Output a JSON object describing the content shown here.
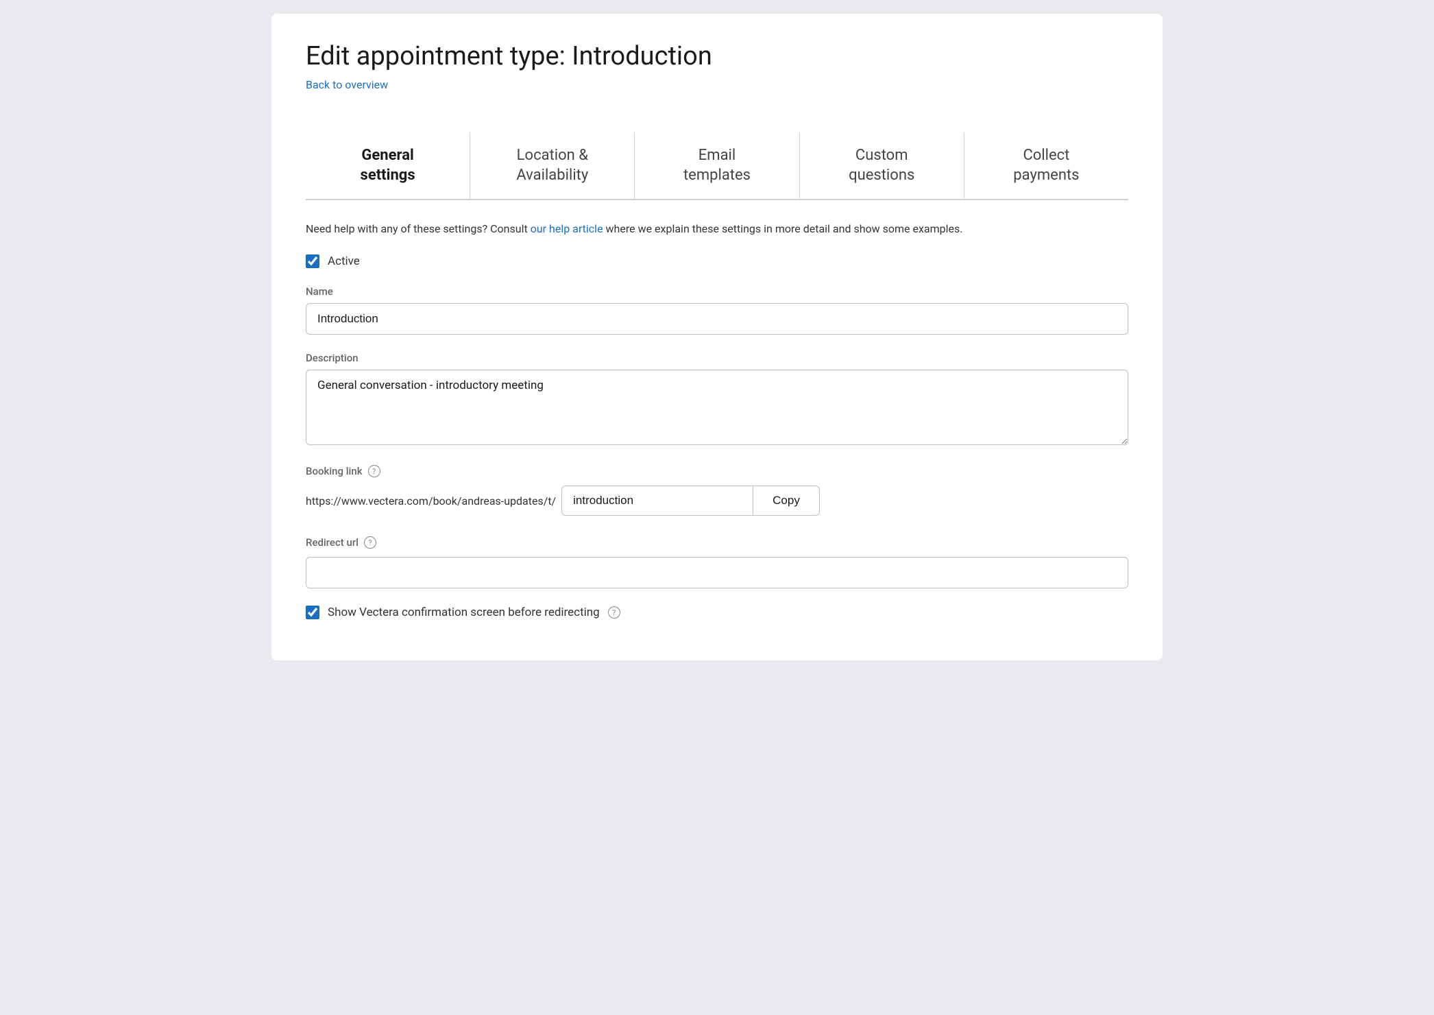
{
  "page": {
    "title": "Edit appointment type: Introduction",
    "back_link": "Back to overview"
  },
  "tabs": [
    {
      "id": "general",
      "label": "General\nsettings",
      "active": true
    },
    {
      "id": "location",
      "label": "Location &\nAvailability",
      "active": false
    },
    {
      "id": "email",
      "label": "Email\ntemplates",
      "active": false
    },
    {
      "id": "custom",
      "label": "Custom\nquestions",
      "active": false
    },
    {
      "id": "payments",
      "label": "Collect\npayments",
      "active": false
    }
  ],
  "help": {
    "text_before": "Need help with any of these settings? Consult ",
    "link_text": "our help article",
    "text_after": " where we explain these settings in more detail and show some examples."
  },
  "active_checkbox": {
    "label": "Active",
    "checked": true
  },
  "name_field": {
    "label": "Name",
    "value": "Introduction",
    "placeholder": ""
  },
  "description_field": {
    "label": "Description",
    "value": "General conversation - introductory meeting",
    "placeholder": ""
  },
  "booking_link": {
    "label": "Booking link",
    "prefix": "https://www.vectera.com/book/andreas-updates/t/",
    "value": "introduction",
    "copy_button_label": "Copy"
  },
  "redirect_url": {
    "label": "Redirect url",
    "value": "",
    "placeholder": "",
    "cursor_visible": true
  },
  "show_confirmation": {
    "label": "Show Vectera confirmation screen before redirecting",
    "checked": true
  },
  "icons": {
    "question_mark": "?",
    "cursor": "|"
  }
}
